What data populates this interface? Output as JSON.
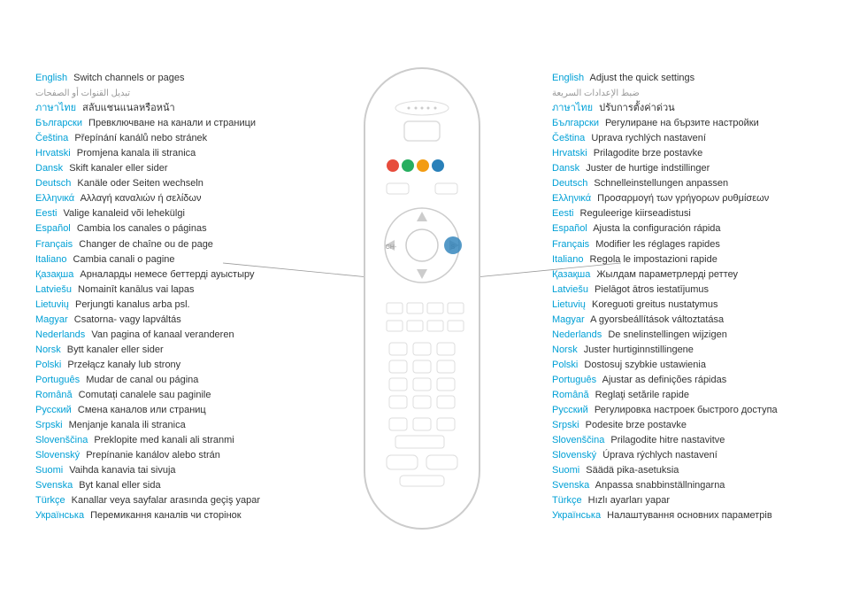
{
  "left": {
    "title": "Switch channels or pages",
    "arabic": "تبديل القنوات أو الصفحات",
    "languages": [
      {
        "name": "English",
        "text": "Switch channels or pages"
      },
      {
        "name": "ภาษาไทย",
        "text": "สลับแชนแนลหรือหน้า"
      },
      {
        "name": "Български",
        "text": "Превключване на канали и страници"
      },
      {
        "name": "Čeština",
        "text": "Přepínání kanálů nebo stránek"
      },
      {
        "name": "Hrvatski",
        "text": "Promjena kanala ili stranica"
      },
      {
        "name": "Dansk",
        "text": "Skift kanaler eller sider"
      },
      {
        "name": "Deutsch",
        "text": "Kanäle oder Seiten wechseln"
      },
      {
        "name": "Ελληνικά",
        "text": "Αλλαγή καναλιών ή σελίδων"
      },
      {
        "name": "Eesti",
        "text": "Valige kanaleid või lehekülgi"
      },
      {
        "name": "Español",
        "text": "Cambia los canales o páginas"
      },
      {
        "name": "Français",
        "text": "Changer de chaîne ou de page"
      },
      {
        "name": "Italiano",
        "text": "Cambia canali o pagine"
      },
      {
        "name": "Қазақша",
        "text": "Арналарды немесе беттерді ауыстыру"
      },
      {
        "name": "Latviešu",
        "text": "Nomainīt kanālus vai lapas"
      },
      {
        "name": "Lietuvių",
        "text": "Perjungti kanalus arba psl."
      },
      {
        "name": "Magyar",
        "text": "Csatorna- vagy lapváltás"
      },
      {
        "name": "Nederlands",
        "text": "Van pagina of kanaal veranderen"
      },
      {
        "name": "Norsk",
        "text": "Bytt kanaler eller sider"
      },
      {
        "name": "Polski",
        "text": "Przełącz kanały lub strony"
      },
      {
        "name": "Português",
        "text": "Mudar de canal ou página"
      },
      {
        "name": "Română",
        "text": "Comutați canalele sau paginile"
      },
      {
        "name": "Русский",
        "text": "Смена каналов или страниц"
      },
      {
        "name": "Srpski",
        "text": "Menjanje kanala ili stranica"
      },
      {
        "name": "Slovenščina",
        "text": "Preklopite med kanali ali stranmi"
      },
      {
        "name": "Slovenský",
        "text": "Prepínanie kanálov alebo strán"
      },
      {
        "name": "Suomi",
        "text": "Vaihda kanavia tai sivuja"
      },
      {
        "name": "Svenska",
        "text": "Byt kanal eller sida"
      },
      {
        "name": "Türkçe",
        "text": "Kanallar veya sayfalar arasında geçiş yapar"
      },
      {
        "name": "Українська",
        "text": "Перемикання каналів чи сторінок"
      }
    ]
  },
  "right": {
    "title": "Adjust the quick settings",
    "arabic": "ضبط الإعدادات السريعة",
    "languages": [
      {
        "name": "English",
        "text": "Adjust the quick settings"
      },
      {
        "name": "ภาษาไทย",
        "text": "ปรับการตั้งค่าด่วน"
      },
      {
        "name": "Български",
        "text": "Регулиране на бързите настройки"
      },
      {
        "name": "Čeština",
        "text": "Uprava rychlých nastavení"
      },
      {
        "name": "Hrvatski",
        "text": "Prilagodite brze postavke"
      },
      {
        "name": "Dansk",
        "text": "Juster de hurtige indstillinger"
      },
      {
        "name": "Deutsch",
        "text": "Schnelleinstellungen anpassen"
      },
      {
        "name": "Ελληνικά",
        "text": "Προσαρμογή των γρήγορων ρυθμίσεων"
      },
      {
        "name": "Eesti",
        "text": "Reguleerige kiirseadistusi"
      },
      {
        "name": "Español",
        "text": "Ajusta la configuración rápida"
      },
      {
        "name": "Français",
        "text": "Modifier les réglages rapides"
      },
      {
        "name": "Italiano",
        "text": "Regola le impostazioni rapide"
      },
      {
        "name": "Қазақша",
        "text": "Жылдам параметрлерді реттеу"
      },
      {
        "name": "Latviešu",
        "text": "Pielāgot ātros iestatījumus"
      },
      {
        "name": "Lietuvių",
        "text": "Koreguoti greitus nustatymus"
      },
      {
        "name": "Magyar",
        "text": "A gyorsbeállítások változtatása"
      },
      {
        "name": "Nederlands",
        "text": "De snelinstellingen wijzigen"
      },
      {
        "name": "Norsk",
        "text": "Juster hurtiginnstillingene"
      },
      {
        "name": "Polski",
        "text": "Dostosuj szybkie ustawienia"
      },
      {
        "name": "Português",
        "text": "Ajustar as definições rápidas"
      },
      {
        "name": "Română",
        "text": "Reglaţi setările rapide"
      },
      {
        "name": "Русский",
        "text": "Регулировка настроек быстрого доступа"
      },
      {
        "name": "Srpski",
        "text": "Podesite brze postavke"
      },
      {
        "name": "Slovenščina",
        "text": "Prilagodite hitre nastavitve"
      },
      {
        "name": "Slovenský",
        "text": "Úprava rýchlych nastavení"
      },
      {
        "name": "Suomi",
        "text": "Säädä pika-asetuksia"
      },
      {
        "name": "Svenska",
        "text": "Anpassa snabbinställningarna"
      },
      {
        "name": "Türkçe",
        "text": "Hızlı ayarları yapar"
      },
      {
        "name": "Українська",
        "text": "Налаштування основних параметрів"
      }
    ]
  }
}
